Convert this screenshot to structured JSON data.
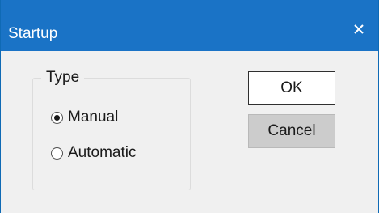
{
  "window": {
    "title": "Startup",
    "close_icon": "close-icon",
    "titlebar_color": "#1a73c6"
  },
  "group": {
    "label": "Type",
    "options": [
      {
        "label": "Manual",
        "checked": true
      },
      {
        "label": "Automatic",
        "checked": false
      }
    ]
  },
  "buttons": {
    "ok_label": "OK",
    "cancel_label": "Cancel"
  }
}
